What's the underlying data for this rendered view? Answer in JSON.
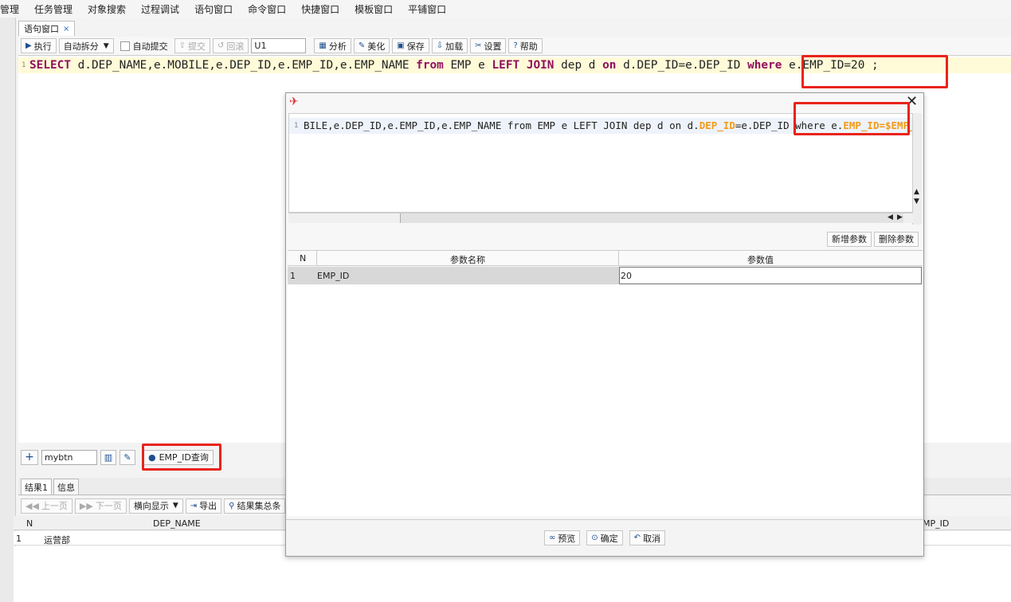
{
  "menu": [
    "管理",
    "任务管理",
    "对象搜索",
    "过程调试",
    "语句窗口",
    "命令窗口",
    "快捷窗口",
    "模板窗口",
    "平铺窗口"
  ],
  "tab": {
    "label": "语句窗口",
    "close": "×"
  },
  "toolbar": {
    "execute": "执行",
    "split_mode": "自动拆分",
    "auto_commit": "自动提交",
    "commit": "提交",
    "rollback": "回滚",
    "schema_value": "U1",
    "analyze": "分析",
    "beautify": "美化",
    "save": "保存",
    "load": "加载",
    "settings": "设置",
    "help": "帮助"
  },
  "editor": {
    "line_no": "1",
    "parts": [
      {
        "t": "SELECT",
        "k": true
      },
      {
        "t": " d.DEP_NAME,e.MOBILE,e.DEP_ID,e.EMP_ID,e.EMP_NAME ",
        "k": false
      },
      {
        "t": "from",
        "k": true
      },
      {
        "t": " EMP e ",
        "k": false
      },
      {
        "t": "LEFT JOIN",
        "k": true
      },
      {
        "t": " dep d ",
        "k": false
      },
      {
        "t": "on",
        "k": true
      },
      {
        "t": " d.DEP_ID=e.DEP_ID ",
        "k": false
      },
      {
        "t": "where",
        "k": true
      },
      {
        "t": " e.EMP_ID=20 ;",
        "k": false
      }
    ]
  },
  "bottom": {
    "add": "+",
    "button_name_value": "mybtn",
    "delete_icon": "trash-icon",
    "edit_icon": "pencil-icon",
    "custom_button": "EMP_ID查询"
  },
  "result_tabs": [
    "结果1",
    "信息"
  ],
  "result_toolbar": {
    "prev": "上一页",
    "next": "下一页",
    "display_mode": "横向显示",
    "export": "导出",
    "summary": "结果集总条"
  },
  "grid": {
    "headers": [
      "N",
      "DEP_NAME",
      "MP_ID"
    ],
    "rows": [
      [
        "1",
        "运营部"
      ]
    ]
  },
  "dialog": {
    "close": "✕",
    "line_no": "1",
    "code_parts": [
      {
        "t": "BILE,e.DEP_ID,e.EMP_ID,e.EMP_NAME from EMP e LEFT JOIN dep d on d.",
        "o": false
      },
      {
        "t": "DEP_ID",
        "o": true
      },
      {
        "t": "=e.DEP_ID where e.",
        "o": false
      },
      {
        "t": "EMP_ID=$EMP_ID",
        "o": true
      },
      {
        "t": " ;",
        "o": false
      }
    ],
    "add_param": "新增参数",
    "delete_param": "删除参数",
    "table_headers": [
      "N",
      "参数名称",
      "参数值"
    ],
    "params": [
      {
        "n": "1",
        "name": "EMP_ID",
        "value": "20"
      }
    ],
    "preview": "预览",
    "ok": "确定",
    "cancel": "取消"
  },
  "colors": {
    "highlight_box": "#e8231b",
    "keyword": "#8f0f5f",
    "param": "#f39a1a"
  }
}
